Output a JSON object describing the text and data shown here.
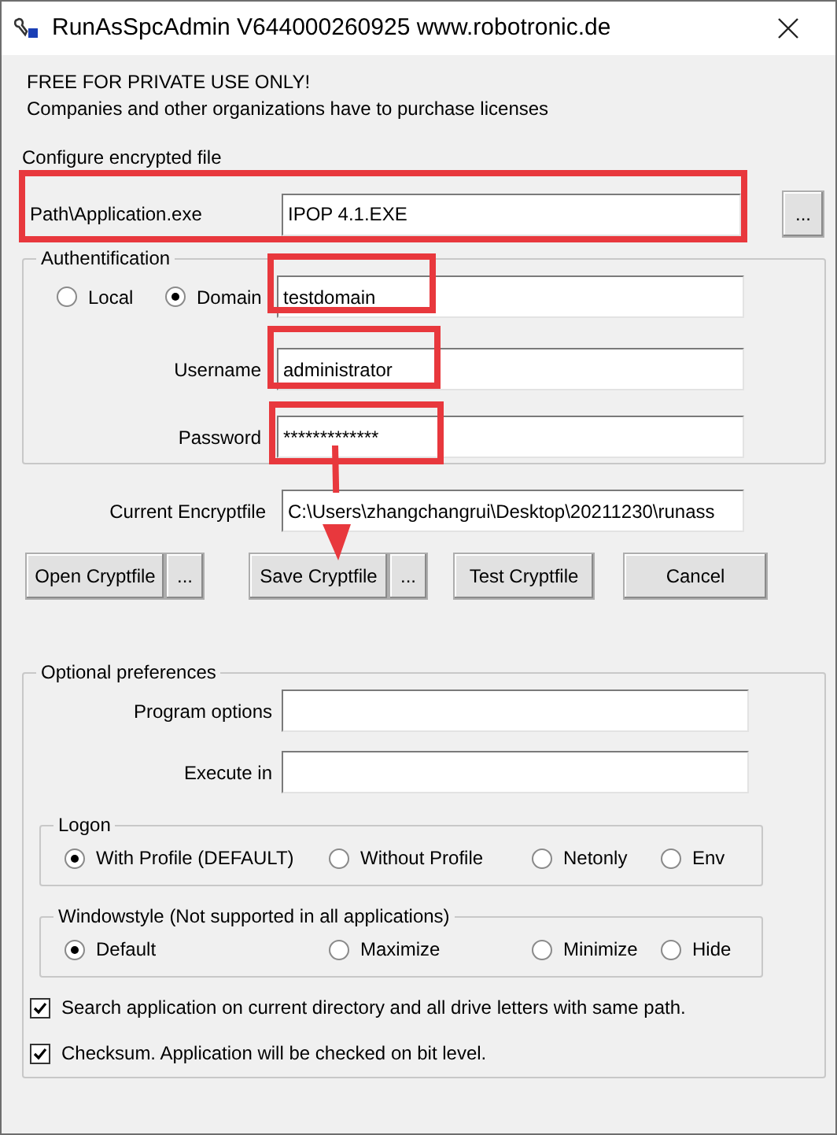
{
  "window": {
    "title": "RunAsSpcAdmin V644000260925 www.robotronic.de"
  },
  "notice": [
    "FREE FOR PRIVATE USE ONLY!",
    "Companies and other organizations have to purchase licenses"
  ],
  "configure": {
    "heading": "Configure encrypted file",
    "path": {
      "label": "Path\\Application.exe",
      "value": "IPOP 4.1.EXE",
      "highlighted": true
    },
    "browse_button": "..."
  },
  "authentication": {
    "legend": "Authentification",
    "options": [
      {
        "label": "Local",
        "selected": false
      },
      {
        "label": "Domain",
        "selected": true
      }
    ],
    "domain": {
      "value": "testdomain",
      "highlighted": true
    },
    "username": {
      "label": "Username",
      "value": "administrator",
      "highlighted": true
    },
    "password": {
      "label": "Password",
      "value": "*************",
      "highlighted": true
    }
  },
  "current_encryptfile": {
    "label": "Current Encryptfile",
    "value": "C:\\Users\\zhangchangrui\\Desktop\\20211230\\runass"
  },
  "buttons": [
    {
      "label": "Open Cryptfile",
      "browse": "..."
    },
    {
      "label": "Save Cryptfile",
      "browse": "..."
    },
    {
      "label": "Test Cryptfile"
    },
    {
      "label": "Cancel"
    }
  ],
  "optional": {
    "legend": "Optional preferences",
    "fields": [
      {
        "label": "Program options"
      },
      {
        "label": "Execute in"
      }
    ],
    "logon": {
      "legend": "Logon",
      "options": [
        {
          "label": "With Profile (DEFAULT)",
          "selected": true
        },
        {
          "label": "Without Profile",
          "selected": false
        },
        {
          "label": "Netonly",
          "selected": false
        },
        {
          "label": "Env",
          "selected": false
        }
      ]
    },
    "windowstyle": {
      "legend": "Windowstyle (Not supported in all applications)",
      "options": [
        {
          "label": "Default",
          "selected": true
        },
        {
          "label": "Maximize",
          "selected": false
        },
        {
          "label": "Minimize",
          "selected": false
        },
        {
          "label": "Hide",
          "selected": false
        }
      ]
    },
    "checkboxes": [
      {
        "label": "Search application on current directory and all drive letters with same path.",
        "checked": true
      },
      {
        "label": "Checksum. Application will be checked on bit level.",
        "checked": true
      }
    ]
  }
}
